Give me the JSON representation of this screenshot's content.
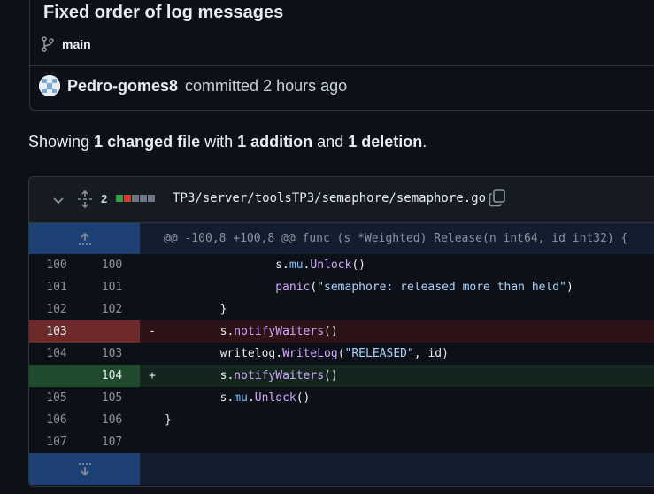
{
  "commit": {
    "title": "Fixed order of log messages",
    "branch": "main",
    "author": "Pedro-gomes8",
    "committed_text": "committed 2 hours ago"
  },
  "summary": {
    "prefix": "Showing",
    "files": "1 changed file",
    "with": "with",
    "additions": "1 addition",
    "and": "and",
    "deletions": "1 deletion",
    "suffix": "."
  },
  "file": {
    "changes": "2",
    "path": "TP3/server/toolsTP3/semaphore/semaphore.go",
    "diffstat_colors": [
      "#2ea043",
      "#da3633",
      "#6e7681",
      "#6e7681",
      "#6e7681"
    ]
  },
  "hunk": {
    "header": "@@ -100,8 +100,8 @@ func (s *Weighted) Release(n int64, id int32) {"
  },
  "lines": [
    {
      "old": "100",
      "new": "100",
      "sign": "",
      "type": "ctx",
      "indent": "                ",
      "tokens": [
        {
          "t": "s.",
          "c": "id"
        },
        {
          "t": "mu",
          "c": "mem"
        },
        {
          "t": ".",
          "c": "id"
        },
        {
          "t": "Unlock",
          "c": "fn"
        },
        {
          "t": "()",
          "c": "id"
        }
      ]
    },
    {
      "old": "101",
      "new": "101",
      "sign": "",
      "type": "ctx",
      "indent": "                ",
      "tokens": [
        {
          "t": "panic",
          "c": "fn"
        },
        {
          "t": "(",
          "c": "id"
        },
        {
          "t": "\"semaphore: released more than held\"",
          "c": "str"
        },
        {
          "t": ")",
          "c": "id"
        }
      ]
    },
    {
      "old": "102",
      "new": "102",
      "sign": "",
      "type": "ctx",
      "indent": "        ",
      "tokens": [
        {
          "t": "}",
          "c": "id"
        }
      ]
    },
    {
      "old": "103",
      "new": "",
      "sign": "-",
      "type": "del",
      "indent": "        ",
      "tokens": [
        {
          "t": "s.",
          "c": "id"
        },
        {
          "t": "notifyWaiters",
          "c": "fn"
        },
        {
          "t": "()",
          "c": "id"
        }
      ]
    },
    {
      "old": "104",
      "new": "103",
      "sign": "",
      "type": "ctx",
      "indent": "        ",
      "tokens": [
        {
          "t": "writelog.",
          "c": "id"
        },
        {
          "t": "WriteLog",
          "c": "fn"
        },
        {
          "t": "(",
          "c": "id"
        },
        {
          "t": "\"RELEASED\"",
          "c": "str"
        },
        {
          "t": ", id)",
          "c": "id"
        }
      ]
    },
    {
      "old": "",
      "new": "104",
      "sign": "+",
      "type": "add",
      "indent": "        ",
      "tokens": [
        {
          "t": "s.",
          "c": "id"
        },
        {
          "t": "notifyWaiters",
          "c": "fn"
        },
        {
          "t": "()",
          "c": "id"
        }
      ]
    },
    {
      "old": "105",
      "new": "105",
      "sign": "",
      "type": "ctx",
      "indent": "        ",
      "tokens": [
        {
          "t": "s.",
          "c": "id"
        },
        {
          "t": "mu",
          "c": "mem"
        },
        {
          "t": ".",
          "c": "id"
        },
        {
          "t": "Unlock",
          "c": "fn"
        },
        {
          "t": "()",
          "c": "id"
        }
      ]
    },
    {
      "old": "106",
      "new": "106",
      "sign": "",
      "type": "ctx",
      "indent": "",
      "tokens": [
        {
          "t": "}",
          "c": "id"
        }
      ]
    },
    {
      "old": "107",
      "new": "107",
      "sign": "",
      "type": "ctx",
      "indent": "",
      "tokens": []
    }
  ],
  "icons": {
    "branch": "git-branch-icon",
    "chevron": "chevron-down-icon",
    "expand": "unfold-icon",
    "copy": "copy-icon",
    "expand_up": "expand-up-icon",
    "expand_down": "expand-down-icon"
  }
}
